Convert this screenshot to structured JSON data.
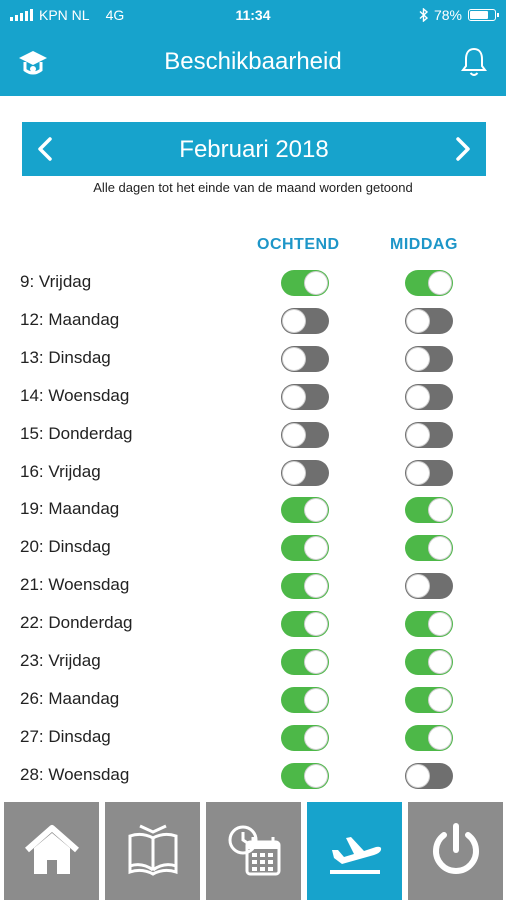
{
  "status": {
    "carrier": "KPN NL",
    "network": "4G",
    "time": "11:34",
    "battery": "78%",
    "battery_level": 0.78
  },
  "header": {
    "title": "Beschikbaarheid",
    "left_icon": "hat-icon",
    "right_icon": "bell-icon"
  },
  "month": {
    "title": "Februari 2018",
    "prev_icon": "chevron-left-icon",
    "next_icon": "chevron-right-icon"
  },
  "note": "Alle dagen tot het einde van de maand worden getoond",
  "columns": {
    "morning": "OCHTEND",
    "afternoon": "MIDDAG"
  },
  "days": [
    {
      "label": "9: Vrijdag",
      "morning": true,
      "afternoon": true
    },
    {
      "label": "12: Maandag",
      "morning": false,
      "afternoon": false
    },
    {
      "label": "13: Dinsdag",
      "morning": false,
      "afternoon": false
    },
    {
      "label": "14: Woensdag",
      "morning": false,
      "afternoon": false
    },
    {
      "label": "15: Donderdag",
      "morning": false,
      "afternoon": false
    },
    {
      "label": "16: Vrijdag",
      "morning": false,
      "afternoon": false
    },
    {
      "label": "19: Maandag",
      "morning": true,
      "afternoon": true
    },
    {
      "label": "20: Dinsdag",
      "morning": true,
      "afternoon": true
    },
    {
      "label": "21: Woensdag",
      "morning": true,
      "afternoon": false
    },
    {
      "label": "22: Donderdag",
      "morning": true,
      "afternoon": true
    },
    {
      "label": "23: Vrijdag",
      "morning": true,
      "afternoon": true
    },
    {
      "label": "26: Maandag",
      "morning": true,
      "afternoon": true
    },
    {
      "label": "27: Dinsdag",
      "morning": true,
      "afternoon": true
    },
    {
      "label": "28: Woensdag",
      "morning": true,
      "afternoon": false
    }
  ],
  "tabs": [
    {
      "icon": "home-icon",
      "active": false
    },
    {
      "icon": "book-icon",
      "active": false
    },
    {
      "icon": "calendar-clock-icon",
      "active": false
    },
    {
      "icon": "airplane-icon",
      "active": true
    },
    {
      "icon": "power-icon",
      "active": false
    }
  ],
  "colors": {
    "brand": "#17a3cc",
    "toggle_on": "#4db848",
    "toggle_off": "#6f6f6f",
    "tab_inactive": "#8c8c8c",
    "column_header": "#1e96c8"
  }
}
